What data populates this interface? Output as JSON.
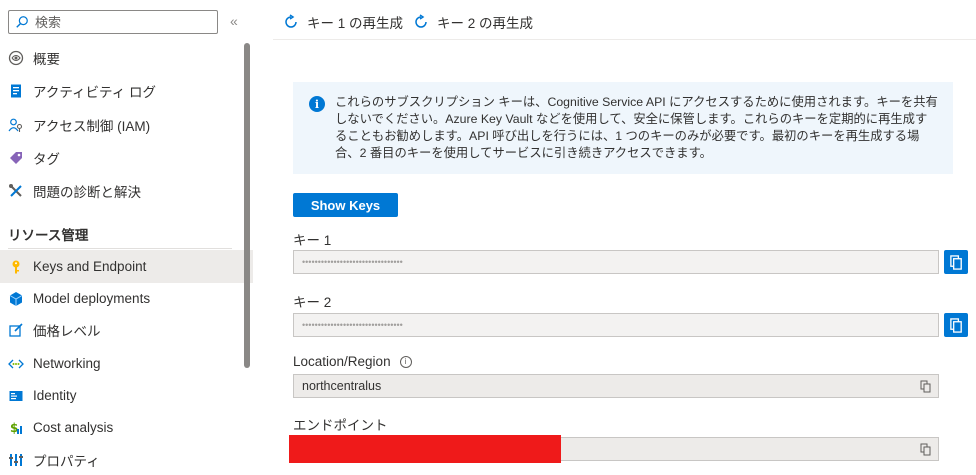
{
  "sidebar": {
    "search_placeholder": "検索",
    "collapse_glyph": "«",
    "items_top": [
      {
        "label": "概要",
        "icon": "overview-icon"
      },
      {
        "label": "アクティビティ ログ",
        "icon": "activity-log-icon"
      },
      {
        "label": "アクセス制御 (IAM)",
        "icon": "iam-icon"
      },
      {
        "label": "タグ",
        "icon": "tag-icon"
      },
      {
        "label": "問題の診断と解決",
        "icon": "diagnose-icon"
      }
    ],
    "section_header": "リソース管理",
    "items_resource": [
      {
        "label": "Keys and Endpoint",
        "icon": "key-icon",
        "selected": true
      },
      {
        "label": "Model deployments",
        "icon": "cube-icon"
      },
      {
        "label": "価格レベル",
        "icon": "edit-icon"
      },
      {
        "label": "Networking",
        "icon": "networking-icon"
      },
      {
        "label": "Identity",
        "icon": "identity-icon"
      },
      {
        "label": "Cost analysis",
        "icon": "cost-icon"
      },
      {
        "label": "プロパティ",
        "icon": "properties-icon"
      }
    ]
  },
  "toolbar": {
    "regen1": "キー 1 の再生成",
    "regen2": "キー 2 の再生成"
  },
  "info": {
    "text": "これらのサブスクリプション キーは、Cognitive Service API にアクセスするために使用されます。キーを共有しないでください。Azure Key Vault などを使用して、安全に保管します。これらのキーを定期的に再生成することもお勧めします。API 呼び出しを行うには、1 つのキーのみが必要です。最初のキーを再生成する場合、2 番目のキーを使用してサービスに引き続きアクセスできます。"
  },
  "show_keys_label": "Show Keys",
  "key1": {
    "label": "キー 1",
    "value": "••••••••••••••••••••••••••••••••"
  },
  "key2": {
    "label": "キー 2",
    "value": "••••••••••••••••••••••••••••••••"
  },
  "location": {
    "label": "Location/Region",
    "value": "northcentralus"
  },
  "endpoint": {
    "label": "エンドポイント",
    "value": ""
  },
  "colors": {
    "accent": "#0078d4",
    "selected_bg": "#edebe9",
    "info_bg": "#eff6fc",
    "redaction": "#ef1a1a"
  }
}
